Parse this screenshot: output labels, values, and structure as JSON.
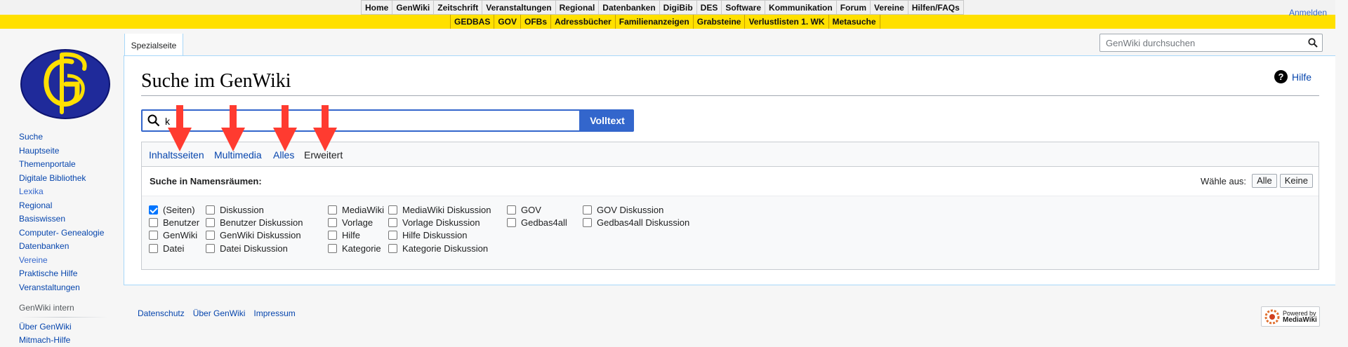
{
  "topnav": {
    "row1": [
      "Home",
      "GenWiki",
      "Zeitschrift",
      "Veranstaltungen",
      "Regional",
      "Datenbanken",
      "DigiBib",
      "DES",
      "Software",
      "Kommunikation",
      "Forum",
      "Vereine",
      "Hilfen/FAQs"
    ],
    "row2": [
      "GEDBAS",
      "GOV",
      "OFBs",
      "Adressbücher",
      "Familienanzeigen",
      "Grabsteine",
      "Verlustlisten 1. WK",
      "Metasuche"
    ],
    "login": "Anmelden"
  },
  "sidebar": {
    "items": [
      "Suche",
      "Hauptseite",
      "Themenportale",
      "Digitale Bibliothek",
      "Lexika",
      "Regional",
      "Basiswissen",
      "Computer- Genealogie",
      "Datenbanken",
      "Vereine",
      "Praktische Hilfe",
      "Veranstaltungen"
    ],
    "section_heading": "GenWiki intern",
    "section_items": [
      "Über GenWiki",
      "Mitmach-Hilfe"
    ]
  },
  "tabs": {
    "special": "Spezialseite"
  },
  "site_search": {
    "placeholder": "GenWiki durchsuchen"
  },
  "page": {
    "title": "Suche im GenWiki",
    "help_label": "Hilfe",
    "query_value": "k",
    "fulltext_button": "Volltext"
  },
  "search_tabs": [
    "Inhaltsseiten",
    "Multimedia",
    "Alles",
    "Erweitert"
  ],
  "namespaces": {
    "heading": "Suche in Namensräumen:",
    "choose_label": "Wähle aus:",
    "all_button": "Alle",
    "none_button": "Keine",
    "columns": [
      [
        {
          "label": "(Seiten)",
          "checked": true
        },
        {
          "label": "Benutzer",
          "checked": false
        },
        {
          "label": "GenWiki",
          "checked": false
        },
        {
          "label": "Datei",
          "checked": false
        }
      ],
      [
        {
          "label": "Diskussion",
          "checked": false
        },
        {
          "label": "Benutzer Diskussion",
          "checked": false
        },
        {
          "label": "GenWiki Diskussion",
          "checked": false
        },
        {
          "label": "Datei Diskussion",
          "checked": false
        }
      ],
      [
        {
          "label": "MediaWiki",
          "checked": false
        },
        {
          "label": "Vorlage",
          "checked": false
        },
        {
          "label": "Hilfe",
          "checked": false
        },
        {
          "label": "Kategorie",
          "checked": false
        }
      ],
      [
        {
          "label": "MediaWiki Diskussion",
          "checked": false
        },
        {
          "label": "Vorlage Diskussion",
          "checked": false
        },
        {
          "label": "Hilfe Diskussion",
          "checked": false
        },
        {
          "label": "Kategorie Diskussion",
          "checked": false
        }
      ],
      [
        {
          "label": "GOV",
          "checked": false
        },
        {
          "label": "Gedbas4all",
          "checked": false
        }
      ],
      [
        {
          "label": "GOV Diskussion",
          "checked": false
        },
        {
          "label": "Gedbas4all Diskussion",
          "checked": false
        }
      ]
    ]
  },
  "footer": {
    "links": [
      "Datenschutz",
      "Über GenWiki",
      "Impressum"
    ],
    "powered_line1": "Powered by",
    "powered_line2": "MediaWiki"
  },
  "colors": {
    "accent": "#3366cc",
    "yellow_bar": "#ffe000",
    "arrow": "#ff3b30"
  }
}
